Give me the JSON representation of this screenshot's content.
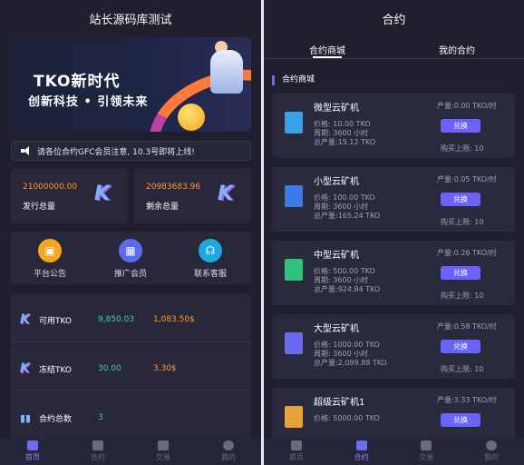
{
  "left": {
    "title": "站长源码库测试",
    "banner": {
      "line1": "TKO新时代",
      "line2": "创新科技 • 引领未来"
    },
    "notice": "请各位合约GFC会员注意, 10.3号即将上线!",
    "stats": [
      {
        "value": "21000000.00",
        "label": "发行总量"
      },
      {
        "value": "20983683.96",
        "label": "剩余总量"
      }
    ],
    "menu": [
      {
        "label": "平台公告",
        "color": "#f5a623"
      },
      {
        "label": "推广会员",
        "color": "#5b6cf0"
      },
      {
        "label": "联系客服",
        "color": "#1ea7e0"
      }
    ],
    "assets": [
      {
        "name": "可用TKO",
        "v1": "9,850.03",
        "v2": "1,083.50$"
      },
      {
        "name": "冻结TKO",
        "v1": "30.00",
        "v2": "3.30$"
      },
      {
        "name": "合约总数",
        "v1": "3",
        "v2": ""
      }
    ],
    "tabs": [
      "首页",
      "合约",
      "交易",
      "我的"
    ]
  },
  "right": {
    "title": "合约",
    "subtabs": [
      "合约商城",
      "我的合约"
    ],
    "section": "合约商城",
    "cards": [
      {
        "name": "微型云矿机",
        "output": "产量:0.00 TKO/时",
        "price": "价格: 10.00 TKO",
        "period": "周期: 3600 小时",
        "total": "总产量:15.12 TKO",
        "btn": "兑换",
        "limit": "购买上限: 10",
        "color": "#3aa0e8"
      },
      {
        "name": "小型云矿机",
        "output": "产量:0.05 TKO/时",
        "price": "价格: 100.00 TKO",
        "period": "周期: 3600 小时",
        "total": "总产量:165.24 TKO",
        "btn": "兑换",
        "limit": "购买上限: 10",
        "color": "#3a7be8"
      },
      {
        "name": "中型云矿机",
        "output": "产量:0.26 TKO/时",
        "price": "价格: 500.00 TKO",
        "period": "周期: 3600 小时",
        "total": "总产量:924.84 TKO",
        "btn": "兑换",
        "limit": "购买上限: 10",
        "color": "#2ec27a"
      },
      {
        "name": "大型云矿机",
        "output": "产量:0.58 TKO/时",
        "price": "价格: 1000.00 TKO",
        "period": "周期: 3600 小时",
        "total": "总产量:2,099.88 TKO",
        "btn": "兑换",
        "limit": "购买上限: 10",
        "color": "#6a6af0"
      },
      {
        "name": "超级云矿机1",
        "output": "产量:3.33 TKO/时",
        "price": "价格: 5000.00 TKO",
        "period": "",
        "total": "",
        "btn": "兑换",
        "limit": "",
        "color": "#e8a23a"
      }
    ],
    "tabs": [
      "首页",
      "合约",
      "交易",
      "我的"
    ]
  }
}
